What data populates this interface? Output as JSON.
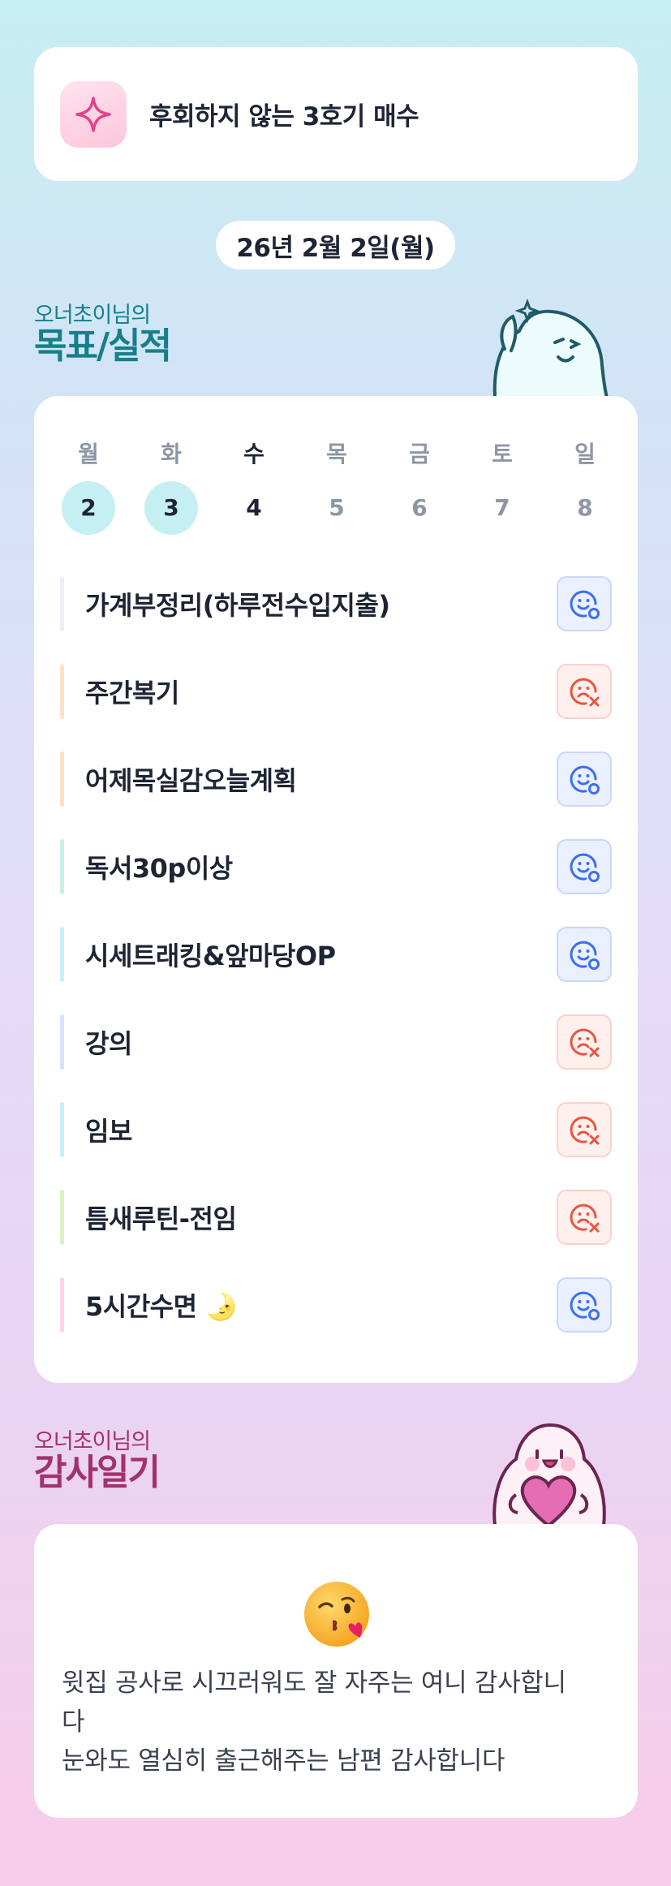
{
  "motto": {
    "icon": "sparkle-icon",
    "text": "후회하지 않는 3호기 매수"
  },
  "date_label": "26년 2월 2일(월)",
  "goal_section": {
    "owner": "오너초이님의",
    "title": "목표/실적"
  },
  "week": {
    "days": [
      {
        "name": "월",
        "num": "2",
        "state": "done"
      },
      {
        "name": "화",
        "num": "3",
        "state": "done"
      },
      {
        "name": "수",
        "num": "4",
        "state": "today"
      },
      {
        "name": "목",
        "num": "5",
        "state": "future"
      },
      {
        "name": "금",
        "num": "6",
        "state": "future"
      },
      {
        "name": "토",
        "num": "7",
        "state": "future"
      },
      {
        "name": "일",
        "num": "8",
        "state": "future"
      }
    ]
  },
  "goals": [
    {
      "label": "가계부정리(하루전수입지출)",
      "status": "success",
      "color": "#eceff3"
    },
    {
      "label": "주간복기",
      "status": "fail",
      "color": "#fde3c4"
    },
    {
      "label": "어제목실감오늘계획",
      "status": "success",
      "color": "#fde3c4"
    },
    {
      "label": "독서30p이상",
      "status": "success",
      "color": "#c8f0e6"
    },
    {
      "label": "시세트래킹&앞마당OP",
      "status": "success",
      "color": "#c8eff6"
    },
    {
      "label": "강의",
      "status": "fail",
      "color": "#d6e3fb"
    },
    {
      "label": "임보",
      "status": "fail",
      "color": "#c8eff6"
    },
    {
      "label": "틈새루틴-전임",
      "status": "fail",
      "color": "#daf1c6"
    },
    {
      "label": "5시간수면 🌛",
      "status": "success",
      "color": "#fbd4e6"
    }
  ],
  "thanks_section": {
    "owner": "오너초이님의",
    "title": "감사일기"
  },
  "thanks_entry": {
    "emoji": "kissing-wink-emoji",
    "text": "윗집 공사로 시끄러워도 잘 자주는 여니 감사합니\n다\n눈와도 열심히 출근해주는 남편 감사합니다"
  },
  "colors": {
    "goal_accent": "#167f8a",
    "thanks_accent": "#a3306f",
    "success_icon": "#3b6ff0",
    "fail_icon": "#e8553f"
  }
}
